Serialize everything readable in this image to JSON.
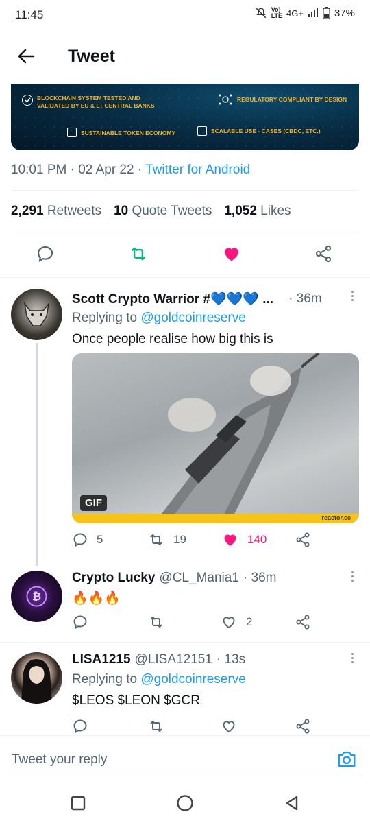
{
  "status_bar": {
    "time": "11:45",
    "network": "4G+",
    "battery": "37%"
  },
  "header": {
    "title": "Tweet"
  },
  "banner": {
    "items": [
      "BLOCKCHAIN SYSTEM TESTED AND VALIDATED BY EU & LT CENTRAL BANKS",
      "REGULATORY COMPLIANT BY DESIGN",
      "SUSTAINABLE TOKEN ECONOMY",
      "SCALABLE USE - CASES (CBDC, etc.)"
    ]
  },
  "tweet": {
    "time": "10:01 PM",
    "date": "02 Apr 22",
    "source": "Twitter for Android",
    "retweets": "2,291",
    "retweets_label": "Retweets",
    "quotes": "10",
    "quotes_label": "Quote Tweets",
    "likes": "1,052",
    "likes_label": "Likes"
  },
  "replies": [
    {
      "name": "Scott Crypto Warrior #💙💙💙 ...",
      "time": "· 36m",
      "replying_prefix": "Replying to",
      "replying_to": "@goldcoinreserve",
      "text": "Once people realise how big this is",
      "media": {
        "badge": "GIF",
        "watermark": "reactor.cc"
      },
      "counts": {
        "replies": "5",
        "retweets": "19",
        "likes": "140"
      }
    },
    {
      "name": "Crypto Lucky",
      "handle": "@CL_Mania1",
      "time": "· 36m",
      "text": "🔥🔥🔥",
      "counts": {
        "likes": "2"
      }
    },
    {
      "name": "LISA1215",
      "handle": "@LISA12151",
      "time": "· 13s",
      "replying_prefix": "Replying to",
      "replying_to": "@goldcoinreserve",
      "text": "$LEOS $LEON $GCR"
    }
  ],
  "reply_input": {
    "placeholder": "Tweet your reply"
  },
  "colors": {
    "accent": "#1d9bf0",
    "retweet": "#00ba7c",
    "like": "#f91880",
    "muted": "#536471"
  }
}
